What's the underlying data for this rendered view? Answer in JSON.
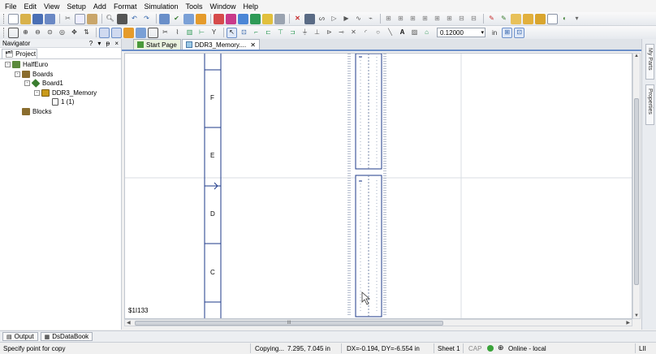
{
  "menu": [
    "File",
    "Edit",
    "View",
    "Setup",
    "Add",
    "Format",
    "Simulation",
    "Tools",
    "Window",
    "Help"
  ],
  "toolbar": {
    "zoom_value": "0.12000",
    "unit_label": "in"
  },
  "navigator": {
    "title": "Navigator",
    "header_buttons": [
      "?",
      "▾",
      "ᵽ",
      "×"
    ],
    "tab_label": "Project",
    "tree": [
      {
        "label": "HalfEuro",
        "level": 0,
        "expander": "-",
        "icon": "project-icon",
        "color": "#5b8a3c"
      },
      {
        "label": "Boards",
        "level": 1,
        "expander": "-",
        "icon": "boards-folder-icon",
        "color": "#8a6d2e"
      },
      {
        "label": "Board1",
        "level": 2,
        "expander": "-",
        "icon": "board-icon",
        "color": "#3a7d2f"
      },
      {
        "label": "DDR3_Memory",
        "level": 3,
        "expander": "-",
        "icon": "schematic-icon",
        "color": "#c99a1a"
      },
      {
        "label": "1 (1)",
        "level": 4,
        "expander": "",
        "icon": "sheet-icon",
        "color": "#ffffff"
      },
      {
        "label": "Blocks",
        "level": 1,
        "expander": "",
        "icon": "blocks-folder-icon",
        "color": "#8a6d2e"
      }
    ]
  },
  "doc_tabs": [
    {
      "label": "Start Page",
      "icon": "start-page-icon",
      "active": false
    },
    {
      "label": "DDR3_Memory....",
      "icon": "schematic-tab-icon",
      "active": true
    }
  ],
  "canvas": {
    "zone_labels": [
      "F",
      "E",
      "D",
      "C"
    ],
    "ref_label": "$1I133"
  },
  "side_tabs": [
    "My Parts",
    "Properties"
  ],
  "bottom_tabs": [
    {
      "label": "Output",
      "icon": "output-icon"
    },
    {
      "label": "DsDataBook",
      "icon": "databook-icon"
    }
  ],
  "status": {
    "prompt": "Specify point for copy",
    "mode": "Copying...",
    "coords": "7.295, 7.045  in",
    "delta": "DX=-0.194, DY=-6.554  in",
    "sheet": "Sheet 1",
    "caps": "CAP",
    "online": "Online - local",
    "extra": "LII"
  },
  "colors": {
    "schematic_border": "#1e3a8a",
    "grid_line": "#d9dde3",
    "tab_accent": "#6b8fc9"
  }
}
